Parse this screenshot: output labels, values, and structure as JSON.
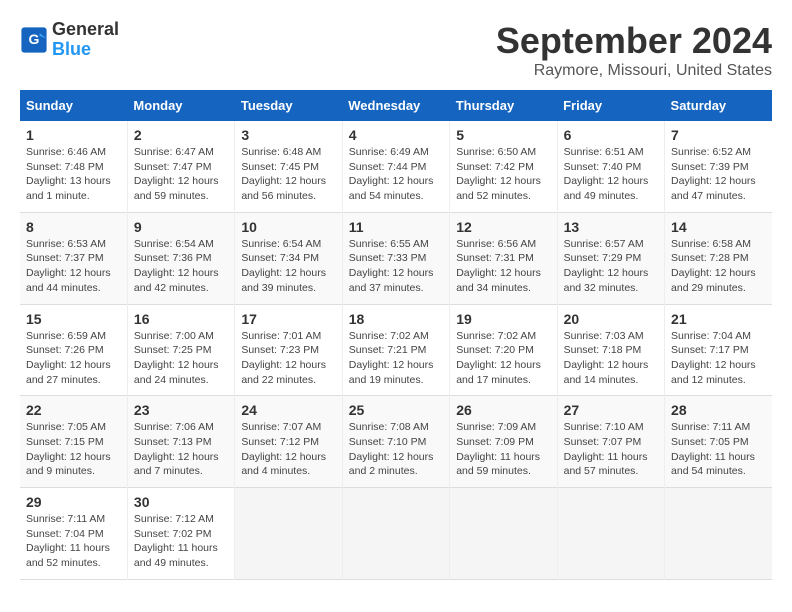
{
  "header": {
    "logo_line1": "General",
    "logo_line2": "Blue",
    "month": "September 2024",
    "location": "Raymore, Missouri, United States"
  },
  "days_of_week": [
    "Sunday",
    "Monday",
    "Tuesday",
    "Wednesday",
    "Thursday",
    "Friday",
    "Saturday"
  ],
  "weeks": [
    [
      {
        "num": "1",
        "info": "Sunrise: 6:46 AM\nSunset: 7:48 PM\nDaylight: 13 hours\nand 1 minute."
      },
      {
        "num": "2",
        "info": "Sunrise: 6:47 AM\nSunset: 7:47 PM\nDaylight: 12 hours\nand 59 minutes."
      },
      {
        "num": "3",
        "info": "Sunrise: 6:48 AM\nSunset: 7:45 PM\nDaylight: 12 hours\nand 56 minutes."
      },
      {
        "num": "4",
        "info": "Sunrise: 6:49 AM\nSunset: 7:44 PM\nDaylight: 12 hours\nand 54 minutes."
      },
      {
        "num": "5",
        "info": "Sunrise: 6:50 AM\nSunset: 7:42 PM\nDaylight: 12 hours\nand 52 minutes."
      },
      {
        "num": "6",
        "info": "Sunrise: 6:51 AM\nSunset: 7:40 PM\nDaylight: 12 hours\nand 49 minutes."
      },
      {
        "num": "7",
        "info": "Sunrise: 6:52 AM\nSunset: 7:39 PM\nDaylight: 12 hours\nand 47 minutes."
      }
    ],
    [
      {
        "num": "8",
        "info": "Sunrise: 6:53 AM\nSunset: 7:37 PM\nDaylight: 12 hours\nand 44 minutes."
      },
      {
        "num": "9",
        "info": "Sunrise: 6:54 AM\nSunset: 7:36 PM\nDaylight: 12 hours\nand 42 minutes."
      },
      {
        "num": "10",
        "info": "Sunrise: 6:54 AM\nSunset: 7:34 PM\nDaylight: 12 hours\nand 39 minutes."
      },
      {
        "num": "11",
        "info": "Sunrise: 6:55 AM\nSunset: 7:33 PM\nDaylight: 12 hours\nand 37 minutes."
      },
      {
        "num": "12",
        "info": "Sunrise: 6:56 AM\nSunset: 7:31 PM\nDaylight: 12 hours\nand 34 minutes."
      },
      {
        "num": "13",
        "info": "Sunrise: 6:57 AM\nSunset: 7:29 PM\nDaylight: 12 hours\nand 32 minutes."
      },
      {
        "num": "14",
        "info": "Sunrise: 6:58 AM\nSunset: 7:28 PM\nDaylight: 12 hours\nand 29 minutes."
      }
    ],
    [
      {
        "num": "15",
        "info": "Sunrise: 6:59 AM\nSunset: 7:26 PM\nDaylight: 12 hours\nand 27 minutes."
      },
      {
        "num": "16",
        "info": "Sunrise: 7:00 AM\nSunset: 7:25 PM\nDaylight: 12 hours\nand 24 minutes."
      },
      {
        "num": "17",
        "info": "Sunrise: 7:01 AM\nSunset: 7:23 PM\nDaylight: 12 hours\nand 22 minutes."
      },
      {
        "num": "18",
        "info": "Sunrise: 7:02 AM\nSunset: 7:21 PM\nDaylight: 12 hours\nand 19 minutes."
      },
      {
        "num": "19",
        "info": "Sunrise: 7:02 AM\nSunset: 7:20 PM\nDaylight: 12 hours\nand 17 minutes."
      },
      {
        "num": "20",
        "info": "Sunrise: 7:03 AM\nSunset: 7:18 PM\nDaylight: 12 hours\nand 14 minutes."
      },
      {
        "num": "21",
        "info": "Sunrise: 7:04 AM\nSunset: 7:17 PM\nDaylight: 12 hours\nand 12 minutes."
      }
    ],
    [
      {
        "num": "22",
        "info": "Sunrise: 7:05 AM\nSunset: 7:15 PM\nDaylight: 12 hours\nand 9 minutes."
      },
      {
        "num": "23",
        "info": "Sunrise: 7:06 AM\nSunset: 7:13 PM\nDaylight: 12 hours\nand 7 minutes."
      },
      {
        "num": "24",
        "info": "Sunrise: 7:07 AM\nSunset: 7:12 PM\nDaylight: 12 hours\nand 4 minutes."
      },
      {
        "num": "25",
        "info": "Sunrise: 7:08 AM\nSunset: 7:10 PM\nDaylight: 12 hours\nand 2 minutes."
      },
      {
        "num": "26",
        "info": "Sunrise: 7:09 AM\nSunset: 7:09 PM\nDaylight: 11 hours\nand 59 minutes."
      },
      {
        "num": "27",
        "info": "Sunrise: 7:10 AM\nSunset: 7:07 PM\nDaylight: 11 hours\nand 57 minutes."
      },
      {
        "num": "28",
        "info": "Sunrise: 7:11 AM\nSunset: 7:05 PM\nDaylight: 11 hours\nand 54 minutes."
      }
    ],
    [
      {
        "num": "29",
        "info": "Sunrise: 7:11 AM\nSunset: 7:04 PM\nDaylight: 11 hours\nand 52 minutes."
      },
      {
        "num": "30",
        "info": "Sunrise: 7:12 AM\nSunset: 7:02 PM\nDaylight: 11 hours\nand 49 minutes."
      },
      {
        "num": "",
        "info": ""
      },
      {
        "num": "",
        "info": ""
      },
      {
        "num": "",
        "info": ""
      },
      {
        "num": "",
        "info": ""
      },
      {
        "num": "",
        "info": ""
      }
    ]
  ]
}
